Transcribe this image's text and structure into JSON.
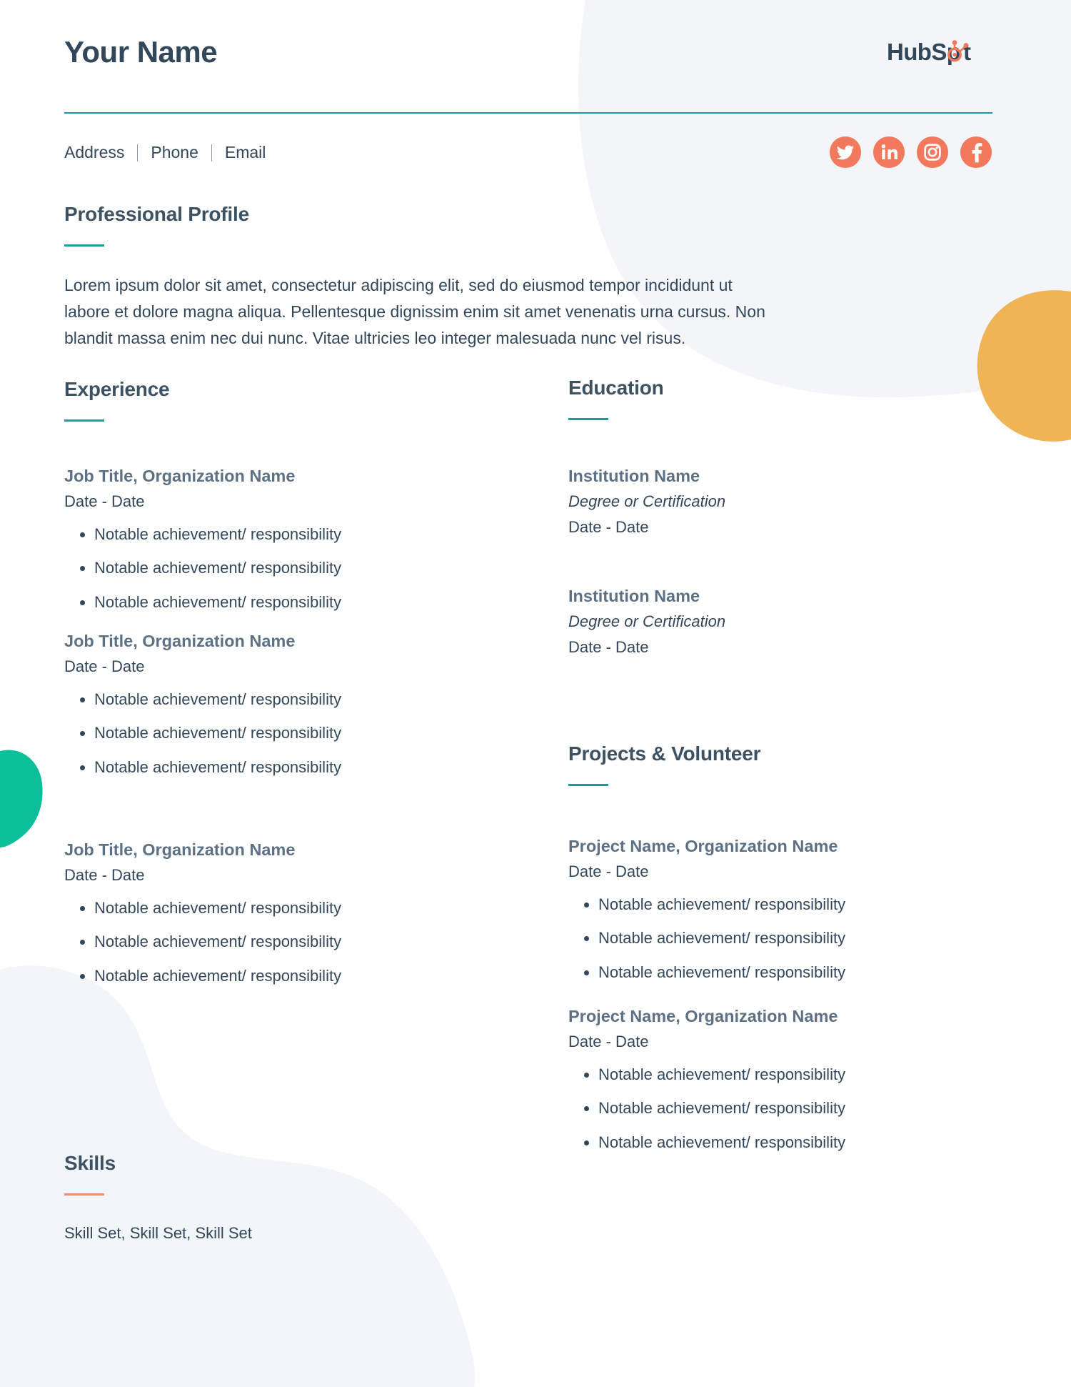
{
  "colors": {
    "accent_teal": "#1a9ba5",
    "accent_orange": "#ef8b6e",
    "heading_navy": "#33475b",
    "subheading_slate": "#5d7184",
    "blob_yellow": "#eeb košice",
    "blob_green": "#0bb services"
  },
  "header": {
    "name": "Your Name",
    "logo_text": "HubSpot",
    "contact": {
      "address": "Address",
      "phone": "Phone",
      "email": "Email",
      "separator": "|"
    },
    "social": [
      {
        "name": "twitter-icon",
        "label": "Twitter"
      },
      {
        "name": "linkedin-icon",
        "label": "LinkedIn"
      },
      {
        "name": "instagram-icon",
        "label": "Instagram"
      },
      {
        "name": "facebook-icon",
        "label": "Facebook"
      }
    ]
  },
  "profile": {
    "title": "Professional Profile",
    "body": "Lorem ipsum dolor sit amet, consectetur adipiscing elit, sed do eiusmod tempor incididunt ut labore et dolore magna aliqua. Pellentesque dignissim enim sit amet venenatis urna cursus. Non blandit massa enim nec dui nunc. Vitae ultricies leo integer malesuada nunc vel risus."
  },
  "experience": {
    "title": "Experience",
    "entries": [
      {
        "title": "Job Title, Organization Name",
        "date": "Date - Date",
        "bullets": [
          "Notable achievement/ responsibility",
          "Notable achievement/ responsibility",
          "Notable achievement/ responsibility"
        ]
      },
      {
        "title": "Job Title, Organization Name",
        "date": "Date - Date",
        "bullets": [
          "Notable achievement/ responsibility",
          "Notable achievement/ responsibility",
          "Notable achievement/ responsibility"
        ]
      },
      {
        "title": "Job Title, Organization Name",
        "date": "Date - Date",
        "bullets": [
          "Notable achievement/ responsibility",
          "Notable achievement/ responsibility",
          "Notable achievement/ responsibility"
        ]
      }
    ]
  },
  "skills": {
    "title": "Skills",
    "body": "Skill Set, Skill Set, Skill Set"
  },
  "education": {
    "title": "Education",
    "entries": [
      {
        "institution": "Institution Name",
        "degree": "Degree or Certification",
        "date": "Date - Date"
      },
      {
        "institution": "Institution Name",
        "degree": "Degree or Certification",
        "date": "Date - Date"
      }
    ]
  },
  "projects": {
    "title": "Projects & Volunteer",
    "entries": [
      {
        "title": "Project Name, Organization Name",
        "date": "Date - Date",
        "bullets": [
          "Notable achievement/ responsibility",
          "Notable achievement/ responsibility",
          "Notable achievement/ responsibility"
        ]
      },
      {
        "title": "Project Name, Organization Name",
        "date": "Date - Date",
        "bullets": [
          "Notable achievement/ responsibility",
          "Notable achievement/ responsibility",
          "Notable achievement/ responsibility"
        ]
      }
    ]
  }
}
